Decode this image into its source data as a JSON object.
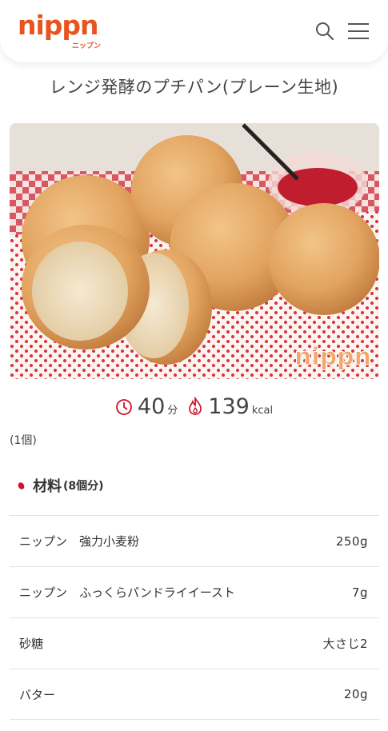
{
  "header": {
    "logo_text": "nippn",
    "logo_kana": "ニップン",
    "icons": [
      "search-icon",
      "menu-icon"
    ]
  },
  "recipe": {
    "title": "レンジ発酵のプチパン(プレーン生地)",
    "photo_watermark": "nippn",
    "time_value": "40",
    "time_unit": "分",
    "calorie_value": "139",
    "calorie_unit": "kcal",
    "serving_note": "(1個)"
  },
  "ingredients": {
    "heading": "材料",
    "yield": "(8個分)",
    "items": [
      {
        "name": "ニップン　強力小麦粉",
        "amount": "250g"
      },
      {
        "name": "ニップン　ふっくらパンドライイースト",
        "amount": "7g"
      },
      {
        "name": "砂糖",
        "amount": "大さじ2"
      },
      {
        "name": "バター",
        "amount": "20g"
      }
    ]
  },
  "colors": {
    "brand": "#e8541f",
    "accent_red": "#d0112b",
    "text": "#333333",
    "divider": "#e2e2e2"
  }
}
